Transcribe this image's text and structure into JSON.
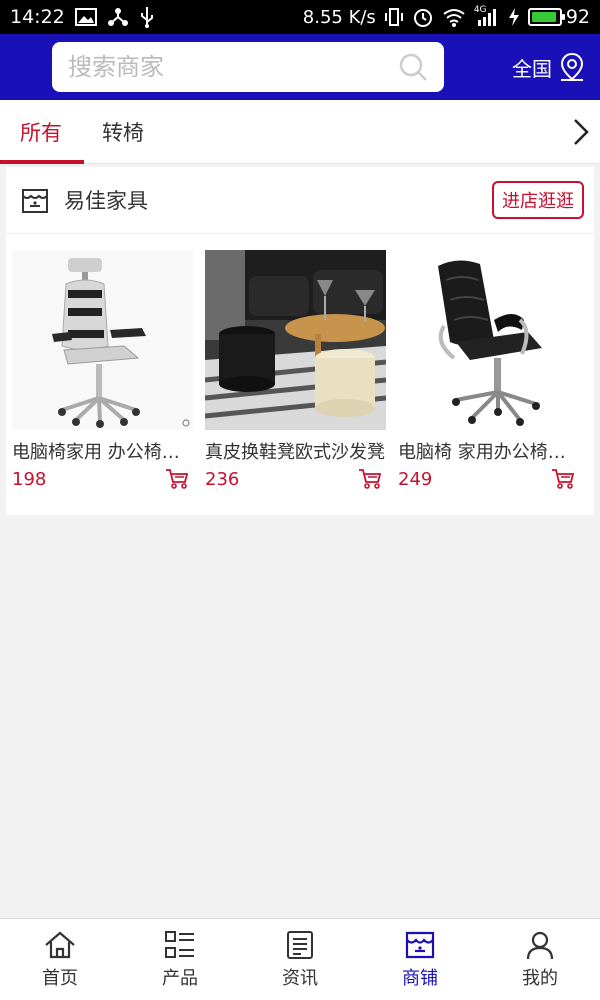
{
  "status_bar": {
    "time": "14:22",
    "speed": "8.55 K/s",
    "network": "4G",
    "battery": "92",
    "battery_level": 0.92
  },
  "header": {
    "search_placeholder": "搜索商家",
    "region_label": "全国"
  },
  "tabs": [
    {
      "label": "所有",
      "active": true
    },
    {
      "label": "转椅",
      "active": false
    }
  ],
  "store": {
    "name": "易佳家具",
    "visit_label": "进店逛逛",
    "products": [
      {
        "title": "电脑椅家用 办公椅子 电竞游戏椅",
        "price": "198"
      },
      {
        "title": "真皮换鞋凳欧式沙发凳",
        "price": "236"
      },
      {
        "title": "电脑椅 家用办公椅子老板椅",
        "price": "249"
      }
    ]
  },
  "bottom_nav": [
    {
      "label": "首页",
      "icon": "home-icon",
      "active": false
    },
    {
      "label": "产品",
      "icon": "list-icon",
      "active": false
    },
    {
      "label": "资讯",
      "icon": "news-icon",
      "active": false
    },
    {
      "label": "商铺",
      "icon": "shop-icon",
      "active": true
    },
    {
      "label": "我的",
      "icon": "user-icon",
      "active": false
    }
  ],
  "colors": {
    "brand_blue": "#1a10b8",
    "accent_red": "#c8102e"
  }
}
